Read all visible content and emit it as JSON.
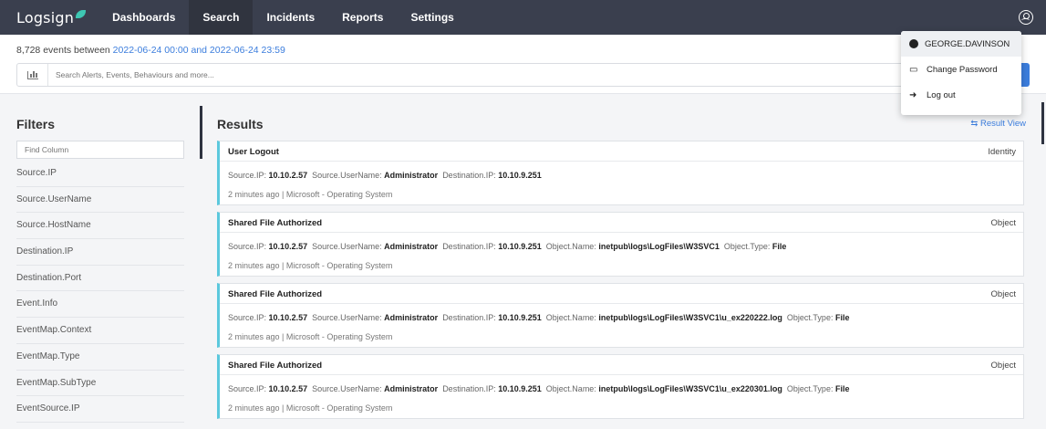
{
  "nav": {
    "logo": "Logsign",
    "items": [
      {
        "label": "Dashboards"
      },
      {
        "label": "Search"
      },
      {
        "label": "Incidents"
      },
      {
        "label": "Reports"
      },
      {
        "label": "Settings"
      }
    ]
  },
  "summary": {
    "prefix": "8,728 events between ",
    "range": "2022-06-24 00:00 and 2022-06-24 23:59"
  },
  "search": {
    "placeholder": "Search Alerts, Events, Behaviours and more..."
  },
  "filters": {
    "title": "Filters",
    "find_placeholder": "Find Column",
    "items": [
      "Source.IP",
      "Source.UserName",
      "Source.HostName",
      "Destination.IP",
      "Destination.Port",
      "Event.Info",
      "EventMap.Context",
      "EventMap.Type",
      "EventMap.SubType",
      "EventSource.IP"
    ]
  },
  "results": {
    "title": "Results",
    "view_label": "Result View",
    "cards": [
      {
        "title": "User Logout",
        "category": "Identity",
        "fields": [
          {
            "k": "Source.IP:",
            "v": "10.10.2.57"
          },
          {
            "k": "Source.UserName:",
            "v": "Administrator"
          },
          {
            "k": "Destination.IP:",
            "v": "10.10.9.251"
          }
        ],
        "meta": "2 minutes ago | Microsoft - Operating System"
      },
      {
        "title": "Shared File Authorized",
        "category": "Object",
        "fields": [
          {
            "k": "Source.IP:",
            "v": "10.10.2.57"
          },
          {
            "k": "Source.UserName:",
            "v": "Administrator"
          },
          {
            "k": "Destination.IP:",
            "v": "10.10.9.251"
          },
          {
            "k": "Object.Name:",
            "v": "inetpub\\logs\\LogFiles\\W3SVC1"
          },
          {
            "k": "Object.Type:",
            "v": "File"
          }
        ],
        "meta": "2 minutes ago | Microsoft - Operating System"
      },
      {
        "title": "Shared File Authorized",
        "category": "Object",
        "fields": [
          {
            "k": "Source.IP:",
            "v": "10.10.2.57"
          },
          {
            "k": "Source.UserName:",
            "v": "Administrator"
          },
          {
            "k": "Destination.IP:",
            "v": "10.10.9.251"
          },
          {
            "k": "Object.Name:",
            "v": "inetpub\\logs\\LogFiles\\W3SVC1\\u_ex220222.log"
          },
          {
            "k": "Object.Type:",
            "v": "File"
          }
        ],
        "meta": "2 minutes ago | Microsoft - Operating System"
      },
      {
        "title": "Shared File Authorized",
        "category": "Object",
        "fields": [
          {
            "k": "Source.IP:",
            "v": "10.10.2.57"
          },
          {
            "k": "Source.UserName:",
            "v": "Administrator"
          },
          {
            "k": "Destination.IP:",
            "v": "10.10.9.251"
          },
          {
            "k": "Object.Name:",
            "v": "inetpub\\logs\\LogFiles\\W3SVC1\\u_ex220301.log"
          },
          {
            "k": "Object.Type:",
            "v": "File"
          }
        ],
        "meta": "2 minutes ago | Microsoft - Operating System"
      }
    ]
  },
  "user_menu": {
    "username": "GEORGE.DAVINSON",
    "items": [
      {
        "label": "Change Password",
        "icon": "password-icon"
      },
      {
        "label": "Log out",
        "icon": "logout-icon"
      }
    ]
  },
  "colors": {
    "topbar": "#3a3f4e",
    "accent": "#3b7ddd",
    "card_border": "#5bc8dd",
    "logo_leaf": "#3ec7b3"
  }
}
